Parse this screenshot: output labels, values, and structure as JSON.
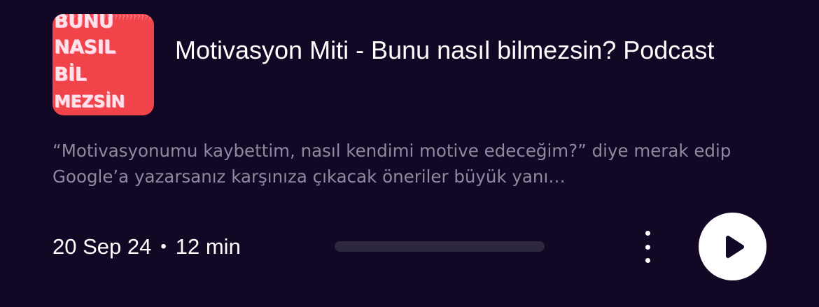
{
  "episode": {
    "cover_art": {
      "lines": [
        "BUNU",
        "NASIL",
        "BİL",
        "MEZSİN"
      ],
      "background_color": "#f0434a"
    },
    "title": "Motivasyon Miti - Bunu nasıl bilmezsin? Podcast",
    "description": "“Motivasyonumu kaybettim, nasıl kendimi motive edeceğim?” diye merak edip Google’a yazarsanız karşınıza çıkacak öneriler büyük yanı…",
    "date": "20 Sep 24",
    "separator": "•",
    "duration": "12 min",
    "progress_fraction": 0,
    "more_icon": "vertical-ellipsis-icon",
    "play_icon": "play-icon"
  },
  "colors": {
    "background": "#120825",
    "title_text": "#ffffff",
    "description_text": "#8e88a0",
    "progress_track": "#2e2740",
    "play_button": "#ffffff"
  }
}
